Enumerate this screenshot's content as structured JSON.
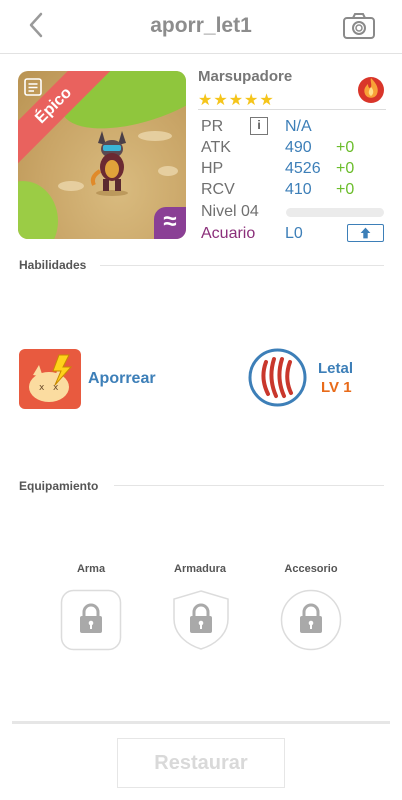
{
  "header": {
    "title": "aporr_let1",
    "back_icon": "chevron-left-icon",
    "camera_icon": "camera-icon"
  },
  "card": {
    "rarity": "Épico",
    "element_symbol": "≈",
    "element_color": "#8a3f95",
    "ribbon_color": "#e9625e"
  },
  "monster": {
    "name": "Marsupadore",
    "stars": "★★★★★",
    "star_count": 5,
    "element_icon": "fire-icon"
  },
  "stats": {
    "pr": {
      "label": "PR",
      "info": "i",
      "value": "N/A"
    },
    "atk": {
      "label": "ATK",
      "value": "490",
      "bonus": "+0"
    },
    "hp": {
      "label": "HP",
      "value": "4526",
      "bonus": "+0"
    },
    "rcv": {
      "label": "RCV",
      "value": "410",
      "bonus": "+0"
    },
    "level": {
      "label": "Nivel 04",
      "progress": 0
    },
    "class": {
      "label": "Acuario",
      "value": "L0"
    }
  },
  "skills": {
    "section_label": "Habilidades",
    "active": {
      "name": "Aporrear"
    },
    "passive": {
      "name": "Letal",
      "level": "LV 1"
    }
  },
  "equipment": {
    "section_label": "Equipamiento",
    "slots": [
      {
        "label": "Arma"
      },
      {
        "label": "Armadura"
      },
      {
        "label": "Accesorio"
      }
    ]
  },
  "footer": {
    "restore_label": "Restaurar"
  },
  "colors": {
    "accent_blue": "#3d7fb8",
    "bonus_green": "#6bbd2b",
    "star": "#f5c51b",
    "level_orange": "#e86b1a"
  }
}
